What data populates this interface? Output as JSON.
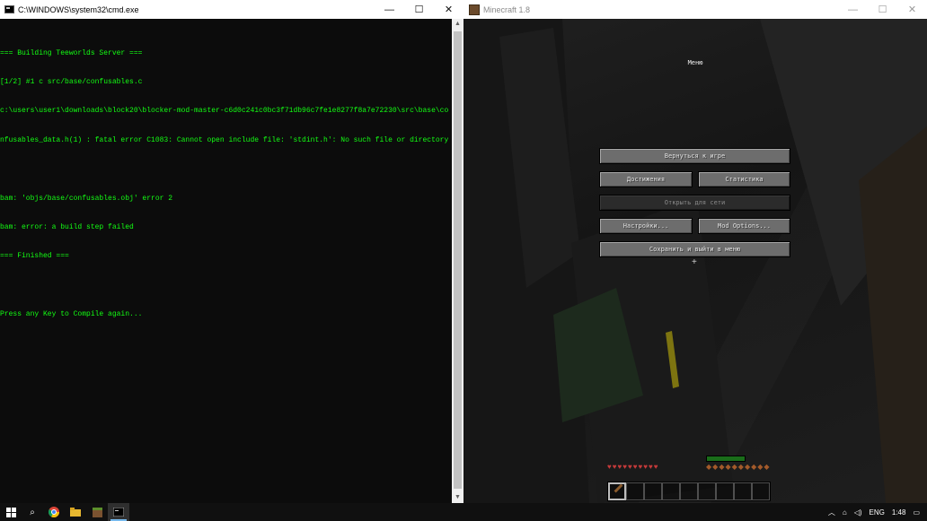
{
  "cmd": {
    "title": "C:\\WINDOWS\\system32\\cmd.exe",
    "lines": [
      "=== Building Teeworlds Server ===",
      "[1/2] #1 c src/base/confusables.c",
      "c:\\users\\user1\\downloads\\block20\\blocker-mod-master-c6d0c241c0bc3f71db96c7fe1e8277f8a7e72230\\src\\base\\co",
      "nfusables_data.h(1) : fatal error C1083: Cannot open include file: 'stdint.h': No such file or directory",
      "",
      "bam: 'objs/base/confusables.obj' error 2",
      "bam: error: a build step failed",
      "=== Finished ===",
      "",
      "Press any Key to Compile again..."
    ]
  },
  "minecraft": {
    "title": "Minecraft 1.8",
    "menu_title": "Меню",
    "buttons": {
      "back_to_game": "Вернуться к игре",
      "achievements": "Достижения",
      "statistics": "Статистика",
      "open_to_lan": "Открыть для сети",
      "options": "Настройки...",
      "mod_options": "Mod Options...",
      "save_and_quit": "Сохранить и выйти в меню"
    }
  },
  "window_controls": {
    "minimize": "—",
    "maximize": "☐",
    "close": "✕"
  },
  "taskbar": {
    "language": "ENG",
    "time": "1:48",
    "icons": [
      "windows-start",
      "search",
      "chrome",
      "file-explorer",
      "minecraft",
      "cmd"
    ]
  }
}
